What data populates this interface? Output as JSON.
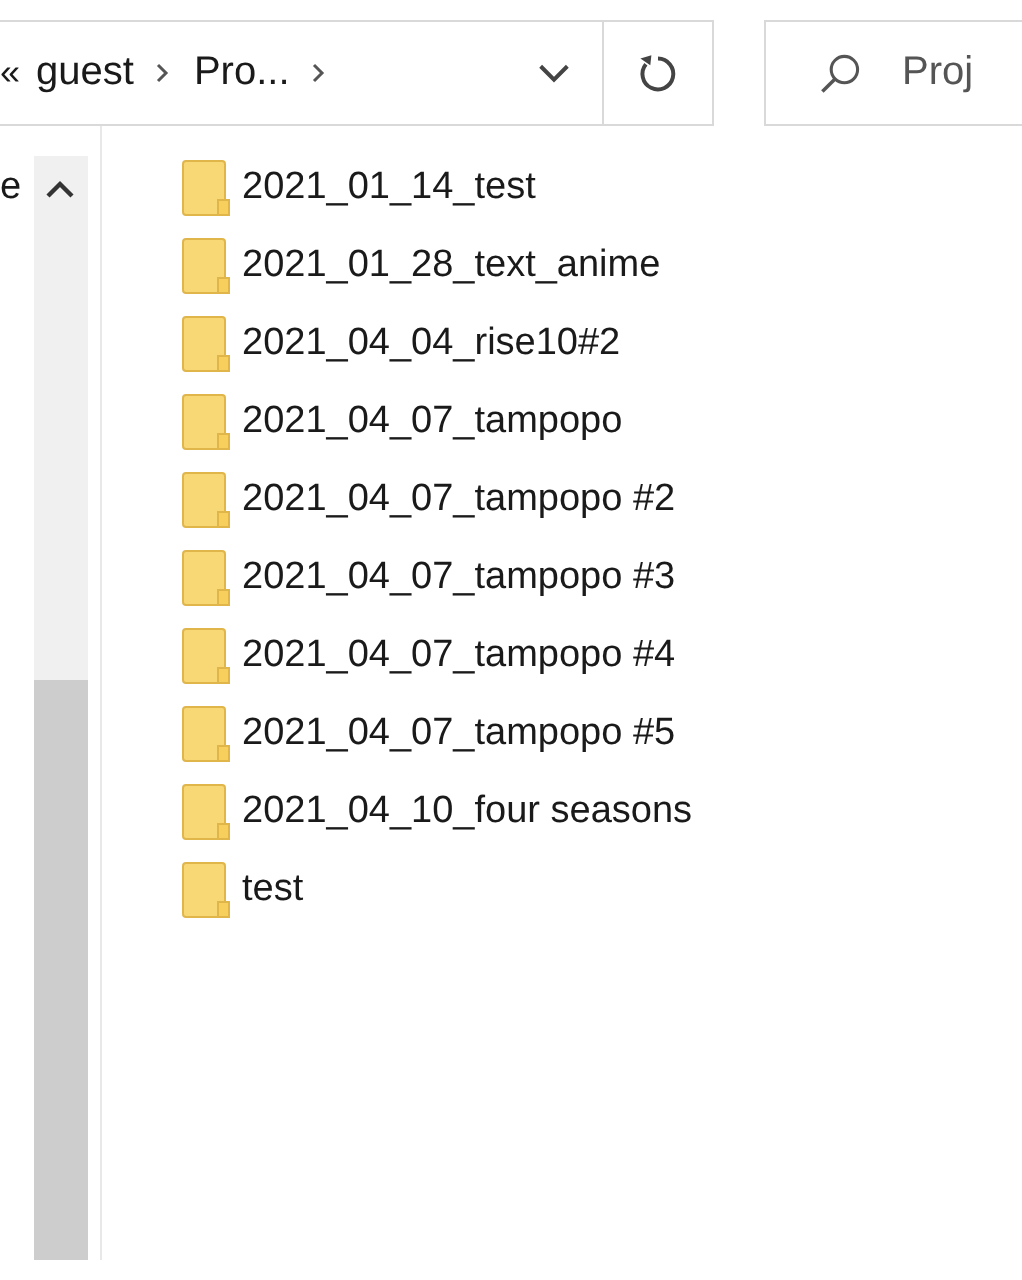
{
  "address_bar": {
    "overflow": "«",
    "crumbs": [
      "guest",
      "Pro..."
    ]
  },
  "search": {
    "placeholder": "Proj"
  },
  "navigation_pane": {
    "item_text": "e"
  },
  "files": [
    {
      "name": "2021_01_14_test"
    },
    {
      "name": "2021_01_28_text_anime"
    },
    {
      "name": "2021_04_04_rise10#2"
    },
    {
      "name": "2021_04_07_tampopo"
    },
    {
      "name": "2021_04_07_tampopo #2"
    },
    {
      "name": "2021_04_07_tampopo #3"
    },
    {
      "name": "2021_04_07_tampopo #4"
    },
    {
      "name": "2021_04_07_tampopo #5"
    },
    {
      "name": "2021_04_10_four seasons"
    },
    {
      "name": "test"
    }
  ]
}
